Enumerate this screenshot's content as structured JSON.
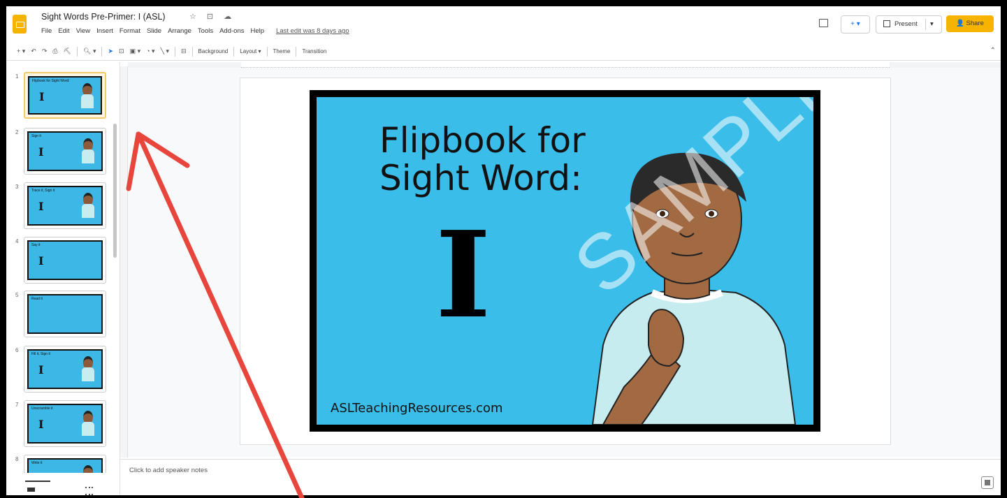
{
  "app": {
    "doc_title": "Sight Words Pre-Primer: I (ASL)",
    "title_icons": "☆ ⊡ ☁",
    "menu": [
      "File",
      "Edit",
      "View",
      "Insert",
      "Format",
      "Slide",
      "Arrange",
      "Tools",
      "Add-ons",
      "Help"
    ],
    "last_edit": "Last edit was 8 days ago",
    "meet_label": "+",
    "present_label": "Present",
    "share_label": "Share",
    "accent_color": "#f6b400"
  },
  "toolbar": {
    "icons": [
      "add-icon",
      "undo-icon",
      "redo-icon",
      "print-icon",
      "paint-format-icon",
      "zoom-icon",
      "select-icon",
      "textbox-icon",
      "image-icon",
      "shape-icon",
      "line-icon",
      "comment-icon"
    ],
    "background_label": "Background",
    "layout_label": "Layout",
    "theme_label": "Theme",
    "transition_label": "Transition"
  },
  "filmstrip": {
    "slides": [
      {
        "num": "1",
        "caption": "Flipbook for Sight Word:"
      },
      {
        "num": "2",
        "caption": "Sign it"
      },
      {
        "num": "3",
        "caption": "Trace it, Sign it"
      },
      {
        "num": "4",
        "caption": "Say it"
      },
      {
        "num": "5",
        "caption": "Read it"
      },
      {
        "num": "6",
        "caption": "Fill it, Sign it"
      },
      {
        "num": "7",
        "caption": "Unscramble it"
      },
      {
        "num": "8",
        "caption": "Write it"
      }
    ]
  },
  "slide": {
    "heading_line1": "Flipbook for",
    "heading_line2": "Sight Word:",
    "word": "I",
    "site": "ASLTeachingResources.com",
    "watermark": "SAMPLE",
    "bg_color": "#3bbde9"
  },
  "notes": {
    "placeholder": "Click to add speaker notes"
  },
  "annotation": {
    "arrow_color": "#e8453c"
  }
}
